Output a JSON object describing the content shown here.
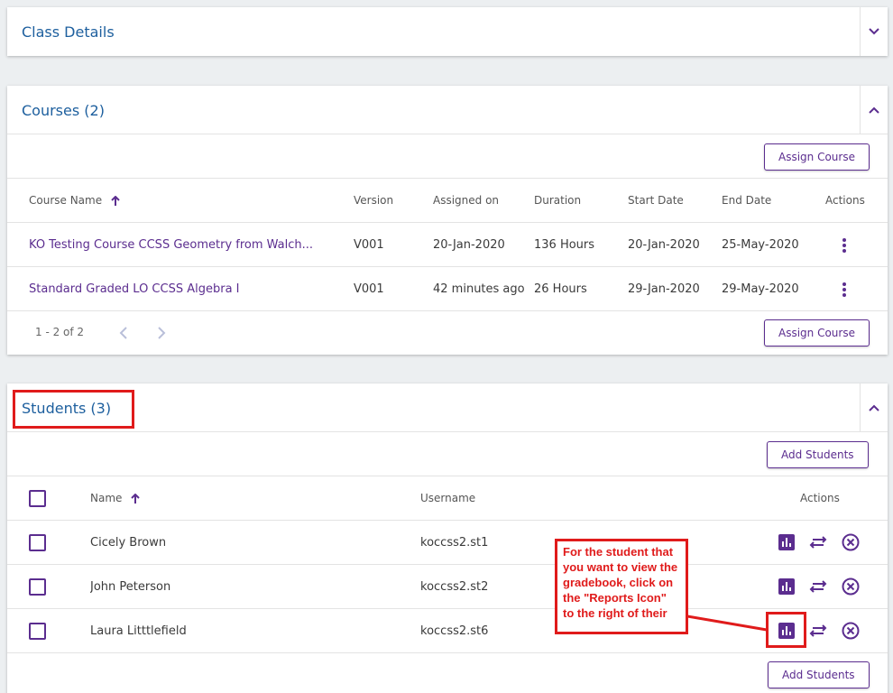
{
  "class_details": {
    "title": "Class Details"
  },
  "courses": {
    "title": "Courses (2)",
    "assign_button": "Assign Course",
    "columns": {
      "name": "Course Name",
      "version": "Version",
      "assigned_on": "Assigned on",
      "duration": "Duration",
      "start": "Start Date",
      "end": "End Date",
      "actions": "Actions"
    },
    "rows": [
      {
        "name": "KO Testing Course CCSS Geometry from Walch...",
        "version": "V001",
        "assigned_on": "20-Jan-2020",
        "duration": "136 Hours",
        "start": "20-Jan-2020",
        "end": "25-May-2020"
      },
      {
        "name": "Standard Graded LO CCSS Algebra I",
        "version": "V001",
        "assigned_on": "42 minutes ago",
        "duration": "26 Hours",
        "start": "29-Jan-2020",
        "end": "29-May-2020"
      }
    ],
    "pagination": {
      "range": "1 - 2 of 2"
    }
  },
  "students": {
    "title": "Students (3)",
    "add_button": "Add Students",
    "columns": {
      "name": "Name",
      "username": "Username",
      "actions": "Actions"
    },
    "rows": [
      {
        "name": "Cicely Brown",
        "username": "koccss2.st1"
      },
      {
        "name": "John Peterson",
        "username": "koccss2.st2"
      },
      {
        "name": "Laura Litttlefield",
        "username": "koccss2.st6"
      }
    ]
  },
  "annotation": {
    "text": "For the student that you want to view the gradebook, click on the \"Reports Icon\" to the right of their",
    "color": "#e01b1b"
  },
  "colors": {
    "accent": "#5b2d8f",
    "title_blue": "#1d5f9e",
    "background": "#eceff1"
  },
  "icons": {
    "collapse": "chevron-down-icon",
    "expand": "chevron-up-icon",
    "sort": "arrow-up-icon",
    "menu": "more-vertical-icon",
    "prev": "chevron-left-icon",
    "next": "chevron-right-icon",
    "reports": "bar-chart-icon",
    "transfer": "swap-icon",
    "remove": "close-circle-icon"
  }
}
